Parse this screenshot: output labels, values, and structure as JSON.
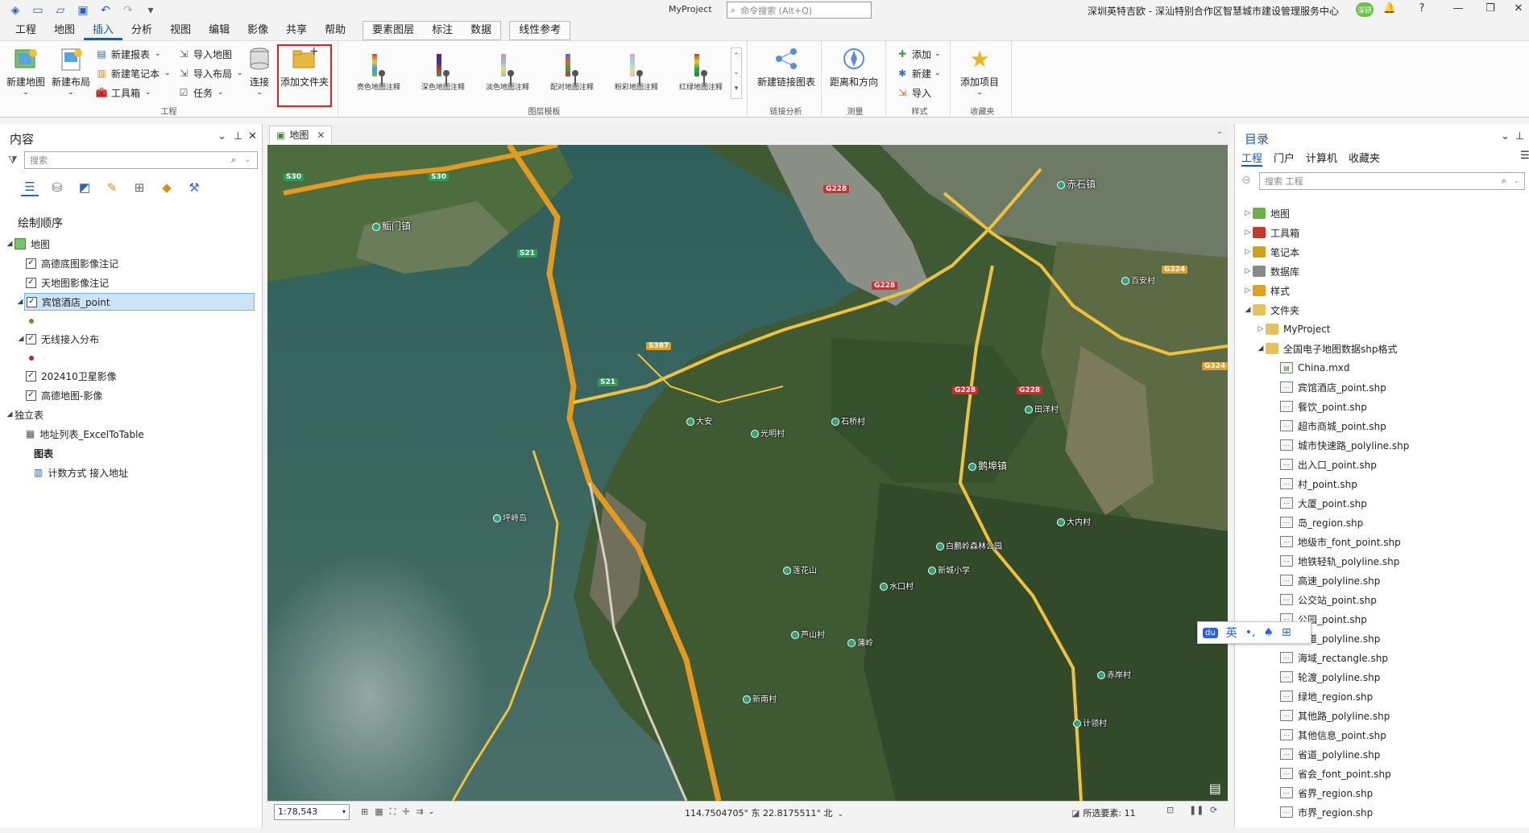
{
  "titlebar": {
    "project": "MyProject",
    "search_placeholder": "命令搜索 (Alt+Q)",
    "org": "深圳英特吉欧 - 深汕特别合作区智慧城市建设管理服务中心",
    "user": "深研"
  },
  "tabs": [
    "工程",
    "地图",
    "插入",
    "分析",
    "视图",
    "编辑",
    "影像",
    "共享",
    "帮助"
  ],
  "active_tab": "插入",
  "context_tabs": [
    "要素图层",
    "标注",
    "数据"
  ],
  "context_tab2": "线性参考",
  "ribbon": {
    "project_group": {
      "label": "工程",
      "new_map": "新建地图",
      "new_layout": "新建布局",
      "new_report": "新建报表",
      "new_notebook": "新建笔记本",
      "toolbox": "工具箱",
      "import_map": "导入地图",
      "import_layout": "导入布局",
      "tasks": "任务",
      "connect": "连接",
      "add_folder": "添加文件夹"
    },
    "layer_templates": {
      "label": "图层模板",
      "items": [
        "亮色地图注释",
        "深色地图注释",
        "淡色地图注释",
        "配对地图注释",
        "粉彩地图注释",
        "红绿地图注释"
      ]
    },
    "link_analysis": {
      "label": "链接分析",
      "new_link_chart": "新建链接图表"
    },
    "measure": {
      "label": "测量",
      "distance_direction": "距离和方向"
    },
    "styles": {
      "label": "样式",
      "add": "添加",
      "new": "新建",
      "import": "导入"
    },
    "favorites": {
      "label": "收藏夹",
      "add_item": "添加项目"
    }
  },
  "contents": {
    "title": "内容",
    "search_placeholder": "搜索",
    "drawing_order": "绘制顺序",
    "map_name": "地图",
    "layers": [
      {
        "name": "高德底图影像注记",
        "checked": true
      },
      {
        "name": "天地图影像注记",
        "checked": true
      },
      {
        "name": "宾馆酒店_point",
        "checked": true,
        "selected": true
      },
      {
        "name": "无线接入分布",
        "checked": true
      },
      {
        "name": "202410卫星影像",
        "checked": true
      },
      {
        "name": "高德地图-影像",
        "checked": true
      }
    ],
    "standalone_tables": "独立表",
    "table_name": "地址列表_ExcelToTable",
    "charts": "图表",
    "chart_name": "计数方式 接入地址"
  },
  "map": {
    "tab": "地图",
    "scale": "1:78,543",
    "coords": "114.7504705° 东 22.8175511° 北",
    "selected_features": "所选要素: 11",
    "labels": [
      {
        "t": "鲘门镇",
        "k": "town"
      },
      {
        "t": "赤石镇",
        "k": "town"
      },
      {
        "t": "鹅埠镇",
        "k": "town"
      },
      {
        "t": "百安村",
        "k": "poi"
      },
      {
        "t": "莲花山",
        "k": "poi"
      },
      {
        "t": "大安",
        "k": "poi"
      },
      {
        "t": "光明村",
        "k": "poi"
      },
      {
        "t": "田洋村",
        "k": "poi"
      },
      {
        "t": "新城小学",
        "k": "poi"
      },
      {
        "t": "坪峙岛",
        "k": "poi"
      },
      {
        "t": "石桥村",
        "k": "poi"
      },
      {
        "t": "赤岸村",
        "k": "poi"
      },
      {
        "t": "大内村",
        "k": "poi"
      },
      {
        "t": "芦山村",
        "k": "poi"
      },
      {
        "t": "计领村",
        "k": "poi"
      },
      {
        "t": "蒲岭",
        "k": "poi"
      },
      {
        "t": "新南村",
        "k": "poi"
      },
      {
        "t": "白鹏岭森林公园",
        "k": "poi"
      },
      {
        "t": "水口村",
        "k": "poi"
      }
    ],
    "shields": [
      {
        "t": "G228",
        "c": "r"
      },
      {
        "t": "G228",
        "c": "r"
      },
      {
        "t": "G228",
        "c": "r"
      },
      {
        "t": "G228",
        "c": "r"
      },
      {
        "t": "S30",
        "c": "g"
      },
      {
        "t": "S30",
        "c": "g"
      },
      {
        "t": "S21",
        "c": "g"
      },
      {
        "t": "S21",
        "c": "g"
      },
      {
        "t": "S387",
        "c": "y"
      },
      {
        "t": "G324",
        "c": "y"
      },
      {
        "t": "G324",
        "c": "y"
      }
    ]
  },
  "catalog": {
    "title": "目录",
    "tabs": [
      "工程",
      "门户",
      "计算机",
      "收藏夹"
    ],
    "search_placeholder": "搜索 工程",
    "top_items": [
      "地图",
      "工具箱",
      "笔记本",
      "数据库",
      "样式",
      "文件夹"
    ],
    "folder_children": [
      "MyProject",
      "全国电子地图数据shp格式"
    ],
    "files": [
      "China.mxd",
      "宾馆酒店_point.shp",
      "餐饮_point.shp",
      "超市商城_point.shp",
      "城市快速路_polyline.shp",
      "出入口_point.shp",
      "村_point.shp",
      "大厦_point.shp",
      "岛_region.shp",
      "地级市_font_point.shp",
      "地铁轻轨_polyline.shp",
      "高速_polyline.shp",
      "公交站_point.shp",
      "公园_point.shp",
      "国道_polyline.shp",
      "海域_rectangle.shp",
      "轮渡_polyline.shp",
      "绿地_region.shp",
      "其他路_polyline.shp",
      "其他信息_point.shp",
      "省道_polyline.shp",
      "省会_font_point.shp",
      "省界_region.shp",
      "市界_region.shp"
    ]
  },
  "ime": {
    "label": "英"
  },
  "colors": {
    "accent": "#1a5bb8",
    "highlight": "#e02020"
  }
}
